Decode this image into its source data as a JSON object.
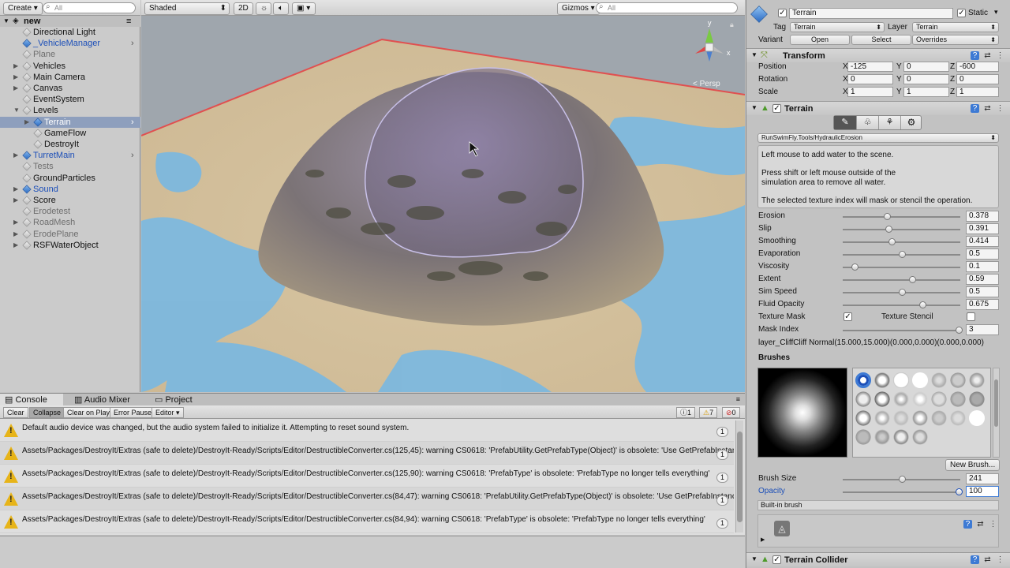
{
  "hierarchy": {
    "create_label": "Create",
    "search_placeholder": "All",
    "scene_name": "new",
    "items": [
      {
        "label": "Directional Light",
        "depth": 1,
        "expand": false,
        "blue": false,
        "dim": false,
        "selected": false
      },
      {
        "label": "_VehicleManager",
        "depth": 1,
        "expand": false,
        "blue": true,
        "dim": false,
        "selected": false
      },
      {
        "label": "Plane",
        "depth": 1,
        "expand": false,
        "blue": false,
        "dim": true,
        "selected": false
      },
      {
        "label": "Vehicles",
        "depth": 1,
        "expand": true,
        "blue": false,
        "dim": false,
        "selected": false
      },
      {
        "label": "Main Camera",
        "depth": 1,
        "expand": true,
        "blue": false,
        "dim": false,
        "selected": false
      },
      {
        "label": "Canvas",
        "depth": 1,
        "expand": true,
        "blue": false,
        "dim": false,
        "selected": false
      },
      {
        "label": "EventSystem",
        "depth": 1,
        "expand": false,
        "blue": false,
        "dim": false,
        "selected": false
      },
      {
        "label": "Levels",
        "depth": 1,
        "expand": true,
        "open": true,
        "blue": false,
        "dim": false,
        "selected": false
      },
      {
        "label": "Terrain",
        "depth": 2,
        "expand": true,
        "blue": true,
        "dim": false,
        "selected": true
      },
      {
        "label": "GameFlow",
        "depth": 2,
        "expand": false,
        "blue": false,
        "dim": false,
        "selected": false
      },
      {
        "label": "DestroyIt",
        "depth": 2,
        "expand": false,
        "blue": false,
        "dim": false,
        "selected": false
      },
      {
        "label": "TurretMain",
        "depth": 1,
        "expand": true,
        "blue": true,
        "dim": false,
        "selected": false
      },
      {
        "label": "Tests",
        "depth": 1,
        "expand": false,
        "blue": false,
        "dim": true,
        "selected": false
      },
      {
        "label": "GroundParticles",
        "depth": 1,
        "expand": false,
        "blue": false,
        "dim": false,
        "selected": false
      },
      {
        "label": "Sound",
        "depth": 1,
        "expand": true,
        "blue": true,
        "dim": false,
        "selected": false
      },
      {
        "label": "Score",
        "depth": 1,
        "expand": true,
        "blue": false,
        "dim": false,
        "selected": false
      },
      {
        "label": "Erodetest",
        "depth": 1,
        "expand": false,
        "blue": false,
        "dim": true,
        "selected": false
      },
      {
        "label": "RoadMesh",
        "depth": 1,
        "expand": true,
        "blue": false,
        "dim": true,
        "selected": false
      },
      {
        "label": "ErodePlane",
        "depth": 1,
        "expand": true,
        "blue": false,
        "dim": true,
        "selected": false
      },
      {
        "label": "RSFWaterObject",
        "depth": 1,
        "expand": true,
        "blue": false,
        "dim": false,
        "selected": false
      }
    ]
  },
  "scene": {
    "shading_mode": "Shaded",
    "mode_2d": "2D",
    "gizmos_label": "Gizmos",
    "search_placeholder": "All",
    "persp_label": "< Persp",
    "axis_y": "y",
    "axis_x": "x"
  },
  "console": {
    "tabs": [
      "Console",
      "Audio Mixer",
      "Project"
    ],
    "toolbar": [
      "Clear",
      "Collapse",
      "Clear on Play",
      "Error Pause",
      "Editor"
    ],
    "counts": {
      "info": "1",
      "warn": "7",
      "error": "0"
    },
    "messages": [
      {
        "text": "Default audio device was changed, but the audio system failed to initialize it. Attempting to reset sound system.",
        "count": "1"
      },
      {
        "text": "Assets/Packages/DestroyIt/Extras (safe to delete)/DestroyIt-Ready/Scripts/Editor/DestructibleConverter.cs(125,45): warning CS0618: 'PrefabUtility.GetPrefabType(Object)' is obsolete: 'Use GetPrefabInstanceStatus'",
        "count": "1"
      },
      {
        "text": "Assets/Packages/DestroyIt/Extras (safe to delete)/DestroyIt-Ready/Scripts/Editor/DestructibleConverter.cs(125,90): warning CS0618: 'PrefabType' is obsolete: 'PrefabType no longer tells everything'",
        "count": "1"
      },
      {
        "text": "Assets/Packages/DestroyIt/Extras (safe to delete)/DestroyIt-Ready/Scripts/Editor/DestructibleConverter.cs(84,47): warning CS0618: 'PrefabUtility.GetPrefabType(Object)' is obsolete: 'Use GetPrefabInstanceStatus'",
        "count": "1"
      },
      {
        "text": "Assets/Packages/DestroyIt/Extras (safe to delete)/DestroyIt-Ready/Scripts/Editor/DestructibleConverter.cs(84,94): warning CS0618: 'PrefabType' is obsolete: 'PrefabType no longer tells everything'",
        "count": "1"
      }
    ]
  },
  "inspector": {
    "object_name": "Terrain",
    "static_label": "Static",
    "tag_label": "Tag",
    "tag_value": "Terrain",
    "layer_label": "Layer",
    "layer_value": "Terrain",
    "variant_label": "Variant",
    "open_label": "Open",
    "select_label": "Select",
    "overrides_label": "Overrides",
    "transform": {
      "title": "Transform",
      "rows": [
        {
          "label": "Position",
          "x": "-125",
          "y": "0",
          "z": "-600"
        },
        {
          "label": "Rotation",
          "x": "0",
          "y": "0",
          "z": "0"
        },
        {
          "label": "Scale",
          "x": "1",
          "y": "1",
          "z": "1"
        }
      ]
    },
    "terrain": {
      "title": "Terrain",
      "tool_dropdown": "RunSwimFly.Tools/HydraulicErosion",
      "help": [
        "Left mouse to add water to the scene.",
        "Press shift or left mouse outside of the",
        "simulation area to remove all water.",
        "The selected texture index will mask or stencil the operation."
      ],
      "sliders": [
        {
          "label": "Erosion",
          "value": "0.378",
          "frac": 0.378
        },
        {
          "label": "Slip",
          "value": "0.391",
          "frac": 0.391
        },
        {
          "label": "Smoothing",
          "value": "0.414",
          "frac": 0.414
        },
        {
          "label": "Evaporation",
          "value": "0.5",
          "frac": 0.5
        },
        {
          "label": "Viscosity",
          "value": "0.1",
          "frac": 0.1
        },
        {
          "label": "Extent",
          "value": "0.59",
          "frac": 0.59
        },
        {
          "label": "Sim Speed",
          "value": "0.5",
          "frac": 0.5
        },
        {
          "label": "Fluid Opacity",
          "value": "0.675",
          "frac": 0.675
        }
      ],
      "texture_mask_label": "Texture Mask",
      "texture_stencil_label": "Texture Stencil",
      "mask_index_label": "Mask Index",
      "mask_index_value": "3",
      "layer_info": "layer_CliffCliff Normal(15.000,15.000)(0.000,0.000)(0.000,0.000)",
      "brushes_label": "Brushes",
      "new_brush_label": "New Brush...",
      "brush_size_label": "Brush Size",
      "brush_size_value": "241",
      "opacity_label": "Opacity",
      "opacity_value": "100",
      "builtin_label": "Built-in brush"
    },
    "collider_title": "Terrain Collider"
  },
  "colors": {
    "selection": "#3e7bd6",
    "accent_blue": "#1c4fb8"
  }
}
